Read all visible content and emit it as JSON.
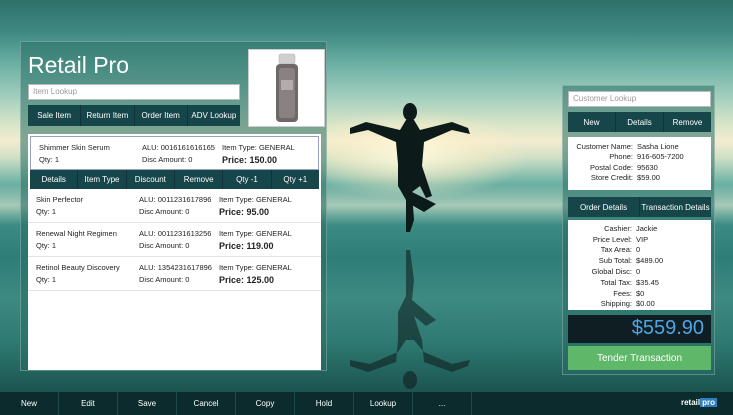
{
  "app": {
    "title": "Retail Pro"
  },
  "item_lookup": {
    "placeholder": "Item Lookup"
  },
  "left_buttons": [
    "Sale Item",
    "Return Item",
    "Order Item",
    "ADV Lookup"
  ],
  "items": [
    {
      "name": "Shimmer Skin Serum",
      "qty": "Qty: 1",
      "alu": "ALU: 0016161616165",
      "disc": "Disc Amount: 0",
      "type": "Item Type: GENERAL",
      "price": "Price: 150.00"
    },
    {
      "name": "Skin Perfector",
      "qty": "Qty: 1",
      "alu": "ALU: 0011231617896",
      "disc": "Disc Amount: 0",
      "type": "Item Type: GENERAL",
      "price": "Price: 95.00"
    },
    {
      "name": "Renewal Night Regimen",
      "qty": "Qty: 1",
      "alu": "ALU: 0011231613256",
      "disc": "Disc Amount: 0",
      "type": "Item Type: GENERAL",
      "price": "Price: 119.00"
    },
    {
      "name": "Retinol Beauty Discovery",
      "qty": "Qty: 1",
      "alu": "ALU: 1354231617896",
      "disc": "Disc Amount: 0",
      "type": "Item Type: GENERAL",
      "price": "Price: 125.00"
    }
  ],
  "item_actions": [
    "Details",
    "Item Type",
    "Discount",
    "Remove",
    "Qty -1",
    "Qty +1"
  ],
  "customer_lookup": {
    "placeholder": "Customer Lookup"
  },
  "customer_buttons": [
    "New",
    "Details",
    "Remove"
  ],
  "customer": {
    "name_label": "Customer Name:",
    "name": "Sasha Lione",
    "phone_label": "Phone:",
    "phone": "916-605-7200",
    "postal_label": "Postal Code:",
    "postal": "95630",
    "credit_label": "Store Credit:",
    "credit": "$59.00"
  },
  "tabs": [
    "Order Details",
    "Transaction Details"
  ],
  "order": {
    "cashier_label": "Cashier:",
    "cashier": "Jackie",
    "price_level_label": "Price Level:",
    "price_level": "VIP",
    "tax_area_label": "Tax Area:",
    "tax_area": "0",
    "subtotal_label": "Sub Total:",
    "subtotal": "$489.00",
    "global_disc_label": "Global Disc:",
    "global_disc": "0",
    "total_tax_label": "Total Tax:",
    "total_tax": "$35.45",
    "fees_label": "Fees:",
    "fees": "$0",
    "shipping_label": "Shipping:",
    "shipping": "$0.00"
  },
  "total": "$559.90",
  "tender_label": "Tender Transaction",
  "bottom_toolbar": [
    "New",
    "Edit",
    "Save",
    "Cancel",
    "Copy",
    "Hold",
    "Lookup",
    "..."
  ],
  "brand": {
    "part1": "retail",
    "part2": "pro"
  },
  "colors": {
    "toolbar": "#16464a",
    "total_text": "#4ea6e6",
    "tender": "#5fb86a"
  }
}
